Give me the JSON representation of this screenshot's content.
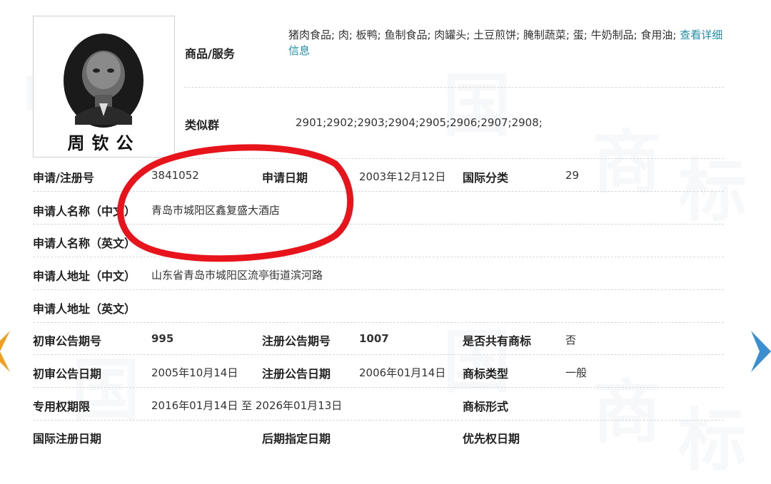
{
  "watermark": [
    "中",
    "国",
    "商",
    "标"
  ],
  "logo": {
    "caption": "周钦公"
  },
  "goods": {
    "label": "商品/服务",
    "value": "猪肉食品; 肉; 板鸭; 鱼制食品; 肉罐头; 土豆煎饼; 腌制蔬菜; 蛋; 牛奶制品; 食用油;",
    "more_link": "查看详细信息"
  },
  "similar_group": {
    "label": "类似群",
    "value": "2901;2902;2903;2904;2905;2906;2907;2908;"
  },
  "fields": {
    "reg_no_label": "申请/注册号",
    "reg_no": "3841052",
    "app_date_label": "申请日期",
    "app_date": "2003年12月12日",
    "intl_class_label": "国际分类",
    "intl_class": "29",
    "applicant_cn_label": "申请人名称（中文）",
    "applicant_cn": "青岛市城阳区鑫复盛大酒店",
    "applicant_en_label": "申请人名称（英文）",
    "applicant_en": "",
    "address_cn_label": "申请人地址（中文）",
    "address_cn": "山东省青岛市城阳区流亭街道滨河路",
    "address_en_label": "申请人地址（英文）",
    "address_en": "",
    "prelim_no_label": "初审公告期号",
    "prelim_no": "995",
    "reg_pub_no_label": "注册公告期号",
    "reg_pub_no": "1007",
    "shared_label": "是否共有商标",
    "shared": "否",
    "prelim_date_label": "初审公告日期",
    "prelim_date": "2005年10月14日",
    "reg_pub_date_label": "注册公告日期",
    "reg_pub_date": "2006年01月14日",
    "mark_type_label": "商标类型",
    "mark_type": "一般",
    "exclusive_label": "专用权期限",
    "exclusive": "2016年01月14日 至 2026年01月13日",
    "mark_form_label": "商标形式",
    "mark_form": "",
    "intl_reg_date_label": "国际注册日期",
    "intl_reg_date": "",
    "later_date_label": "后期指定日期",
    "later_date": "",
    "priority_date_label": "优先权日期",
    "priority_date": ""
  },
  "colors": {
    "link": "#1f8fa8",
    "annotation": "#e8141c",
    "nav_left": "#f0a020",
    "nav_right": "#3a8fd0"
  }
}
